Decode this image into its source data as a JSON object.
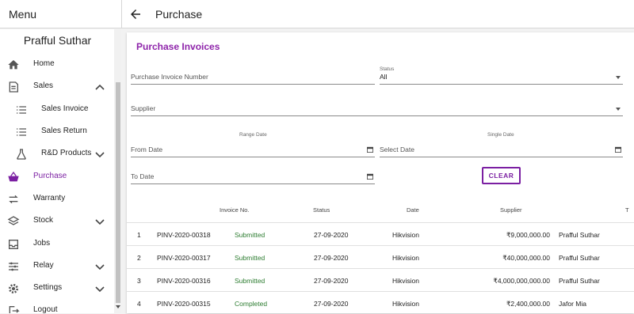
{
  "topbar": {
    "menu_title": "Menu",
    "page_title": "Purchase"
  },
  "sidebar": {
    "user_name": "Prafful Suthar",
    "items": [
      {
        "label": "Home",
        "icon": "home-icon"
      },
      {
        "label": "Sales",
        "icon": "receipt-icon",
        "chevron": "chevron-up-icon"
      },
      {
        "label": "Sales Invoice",
        "icon": "list-icon"
      },
      {
        "label": "Sales Return",
        "icon": "list-icon"
      },
      {
        "label": "R&D Products",
        "icon": "flask-icon",
        "chevron": "chevron-down-icon"
      },
      {
        "label": "Purchase",
        "icon": "basket-icon",
        "active": true
      },
      {
        "label": "Warranty",
        "icon": "swap-icon"
      },
      {
        "label": "Stock",
        "icon": "layers-icon",
        "chevron": "chevron-down-icon"
      },
      {
        "label": "Jobs",
        "icon": "inbox-icon"
      },
      {
        "label": "Relay",
        "icon": "sliders-icon",
        "chevron": "chevron-down-icon"
      },
      {
        "label": "Settings",
        "icon": "gear-icon",
        "chevron": "chevron-down-icon"
      },
      {
        "label": "Logout",
        "icon": "logout-icon"
      }
    ]
  },
  "card": {
    "title": "Purchase Invoices",
    "filters": {
      "invoice_number_placeholder": "Purchase Invoice Number",
      "status_label": "Status",
      "status_value": "All",
      "supplier_placeholder": "Supplier",
      "range_date_label": "Range Date",
      "single_date_label": "Single Date",
      "from_date_placeholder": "From Date",
      "select_date_placeholder": "Select Date",
      "to_date_placeholder": "To Date",
      "clear_label": "CLEAR"
    },
    "table": {
      "headers": [
        "Invoice No.",
        "Status",
        "Date",
        "Supplier",
        "T"
      ],
      "rows": [
        {
          "num": "1",
          "invoice": "PINV-2020-00318",
          "status": "Submitted",
          "date": "27-09-2020",
          "supplier": "Hikvision",
          "amount": "₹9,000,000.00",
          "owner": "Prafful Suthar"
        },
        {
          "num": "2",
          "invoice": "PINV-2020-00317",
          "status": "Submitted",
          "date": "27-09-2020",
          "supplier": "Hikvision",
          "amount": "₹40,000,000.00",
          "owner": "Prafful Suthar"
        },
        {
          "num": "3",
          "invoice": "PINV-2020-00316",
          "status": "Submitted",
          "date": "27-09-2020",
          "supplier": "Hikvision",
          "amount": "₹4,000,000,000.00",
          "owner": "Prafful Suthar"
        },
        {
          "num": "4",
          "invoice": "PINV-2020-00315",
          "status": "Completed",
          "date": "27-09-2020",
          "supplier": "Hikvision",
          "amount": "₹2,400,000.00",
          "owner": "Jafor Mia"
        }
      ]
    }
  },
  "colors": {
    "accent": "#7b1fa2",
    "title": "#8e24aa",
    "status_green": "#2e7d32"
  }
}
